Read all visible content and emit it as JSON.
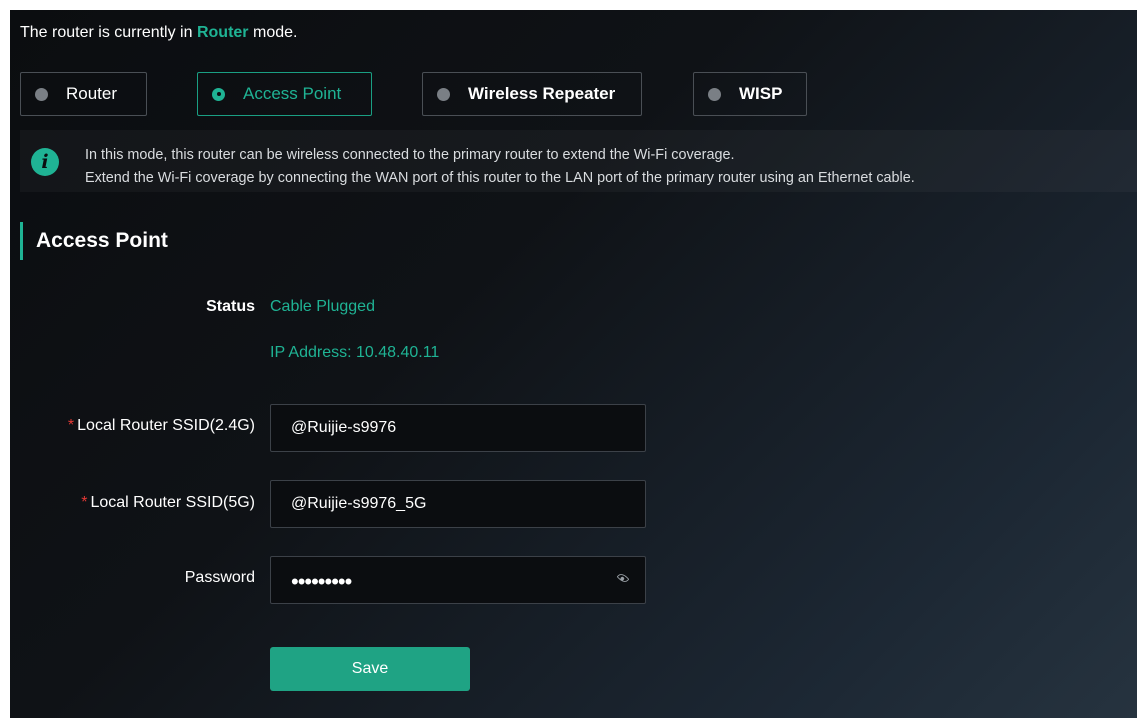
{
  "mode_banner": {
    "prefix": "The router is currently in",
    "current_mode": "Router",
    "suffix": "mode."
  },
  "modes": [
    {
      "label": "Router",
      "selected": false
    },
    {
      "label": "Access Point",
      "selected": true
    },
    {
      "label": "Wireless Repeater",
      "selected": false
    },
    {
      "label": "WISP",
      "selected": false
    }
  ],
  "info": {
    "line1": "In this mode, this router can be wireless connected to the primary router to extend the Wi-Fi coverage.",
    "line2": "Extend the Wi-Fi coverage by connecting the WAN port of this router to the LAN port of the primary router using an Ethernet cable.",
    "icon": "info-icon"
  },
  "section": {
    "title": "Access Point"
  },
  "status": {
    "label": "Status",
    "value": "Cable Plugged",
    "ip": "IP Address: 10.48.40.11"
  },
  "form": {
    "ssid_24": {
      "label": "Local Router SSID(2.4G)",
      "value": "@Ruijie-s9976",
      "required": "*"
    },
    "ssid_5": {
      "label": "Local Router SSID(5G)",
      "value": "@Ruijie-s9976_5G",
      "required": "*"
    },
    "password": {
      "label": "Password",
      "masked": "•••••••••",
      "icon": "eye-icon"
    }
  },
  "save_label": "Save",
  "colors": {
    "accent": "#1fb394",
    "required": "#e53935",
    "background": "#0b0d10"
  }
}
